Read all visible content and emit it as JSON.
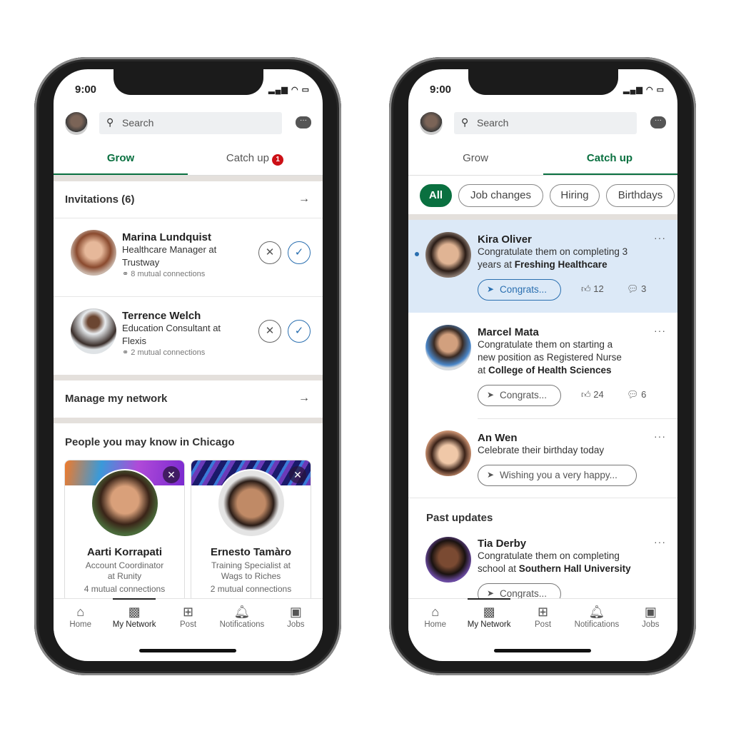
{
  "status": {
    "time": "9:00",
    "signal": "▂▄▆ ◠ ▭"
  },
  "search": {
    "placeholder": "Search"
  },
  "tabs": {
    "grow": "Grow",
    "catch_up": "Catch up",
    "catch_up_badge": "1"
  },
  "left": {
    "invitations": "Invitations (6)",
    "invites": [
      {
        "name": "Marina Lundquist",
        "title": "Healthcare Manager at",
        "company": "Trustway",
        "mutual": "8 mutual connections"
      },
      {
        "name": "Terrence Welch",
        "title": "Education Consultant at",
        "company": "Flexis",
        "mutual": "2 mutual connections"
      }
    ],
    "manage": "Manage my network",
    "pymk_title": "People you may know in Chicago",
    "cards": [
      {
        "name": "Aarti Korrapati",
        "title": "Account Coordinator",
        "company": "at Runity",
        "mutual": "4 mutual connections"
      },
      {
        "name": "Ernesto Tamàro",
        "title": "Training Specialist at",
        "company": "Wags to Riches",
        "mutual": "2 mutual connections"
      }
    ]
  },
  "right": {
    "chips": [
      "All",
      "Job changes",
      "Hiring",
      "Birthdays"
    ],
    "feed": [
      {
        "name": "Kira Oliver",
        "line1": "Congratulate them on completing 3",
        "line2a": "years at ",
        "line2b": "Freshing Healthcare",
        "action": "Congrats...",
        "likes": "12",
        "comments": "3"
      },
      {
        "name": "Marcel Mata",
        "line1": "Congratulate them on starting a",
        "line2": "new position as Registered Nurse",
        "line3a": "at ",
        "line3b": "College of Health Sciences",
        "action": "Congrats...",
        "likes": "24",
        "comments": "6"
      },
      {
        "name": "An Wen",
        "line1": "Celebrate their birthday today",
        "action": "Wishing you a very happy..."
      }
    ],
    "past_updates": "Past updates",
    "past": [
      {
        "name": "Tia Derby",
        "line1": "Congratulate them on completing",
        "line2a": "school at ",
        "line2b": "Southern Hall University",
        "action": "Congrats..."
      }
    ]
  },
  "nav": [
    "Home",
    "My Network",
    "Post",
    "Notifications",
    "Jobs"
  ],
  "colors": {
    "accent": "#0a7040",
    "link": "#2a6fb0",
    "highlight": "#dce9f7",
    "badge": "#cc1016"
  }
}
